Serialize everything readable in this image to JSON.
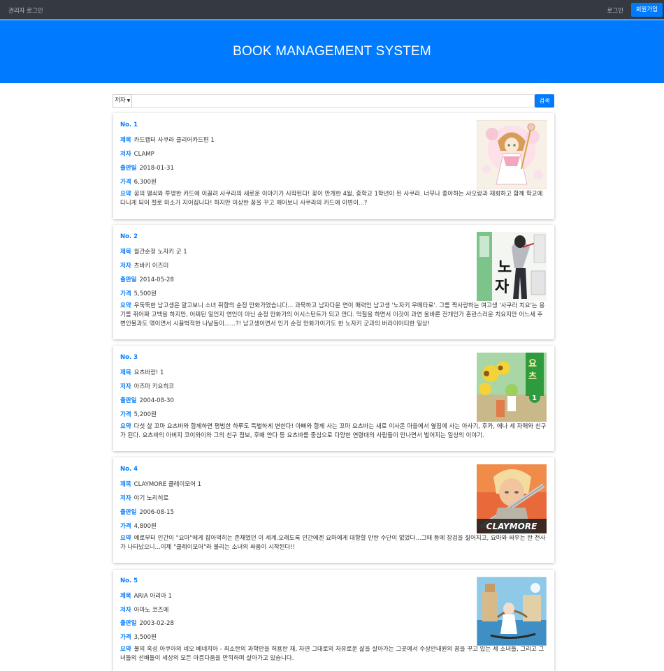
{
  "nav": {
    "admin_login": "관리자 로그인",
    "login": "로그인",
    "signup": "회원가입"
  },
  "hero": {
    "title": "BOOK MANAGEMENT SYSTEM"
  },
  "search": {
    "selected_option": "저자",
    "value": "",
    "button_label": "검색"
  },
  "labels": {
    "title": "제목",
    "author": "저자",
    "published": "출판일",
    "price": "가격",
    "summary": "요약"
  },
  "books": [
    {
      "no": "No. 1",
      "title": "카드캡터 사쿠라 클리어카드편 1",
      "author": "CLAMP",
      "published": "2018-01-31",
      "price": "6,300원",
      "summary": "꿈의 열쇠와 투명한 카드에 이끌려 사쿠라의 새로운 이야기가 시작된다! 꽃이 만개한 4월, 중학교 1학년이 된 사쿠라. 너무나 좋아하는 샤오랑과 재회하고 함께 학교에 다니게 되어 절로 미소가 지어집니다! 하지만 이상한 꿈을 꾸고 깨어보니 사쿠라의 카드에 이변이...?",
      "cover": "sakura-cover"
    },
    {
      "no": "No. 2",
      "title": "월간순정 노자키 군 1",
      "author": "츠바키 이즈미",
      "published": "2014-05-28",
      "price": "5,500원",
      "summary": "우둑뚝한 남고생은 알고보니 소녀 취향의 순정 만화가였습니다... 과묵하고 남자다운 면이 매력인 남고생 '노자키 우메타로'. 그를 짝사랑하는 여고생 '사쿠라 치요'는 용기를 쥐어짜 고백을 하지만, 어찌된 일인지 연인이 아닌 순정 만화가의 어시스턴트가 되고 만다. 먹칠을 하면서 이것이 과연 올바른 전개인가 혼란스러운 치요지만 어느새 주변인물과도 엮이면서 시끌벅적한 나날들이......?! 남고생이면서 인기 순정 만화가이기도 한 노자키 군과의 버라이어티한 일상!",
      "cover": "nozaki-cover"
    },
    {
      "no": "No. 3",
      "title": "요츠바랑! 1",
      "author": "아즈마 키요히코",
      "published": "2004-08-30",
      "price": "5,200원",
      "summary": "다섯 살 꼬마 요츠바와 함께하면 평범한 하루도 특별하게 변한다! 아빠와 함께 사는 꼬마 요츠바는 새로 이사온 마을에서 옆집에 사는 아사기, 후카, 에나 세 자매와 친구가 된다. 요츠바의 아버지 코이와이와 그의 친구 점보, 후배 얀다 등 요츠바를 중심으로 다양한 연령대의 사람들이 만나면서 벌어지는 일상의 이야기.",
      "cover": "yotsuba-cover"
    },
    {
      "no": "No. 4",
      "title": "CLAYMORE 클레이모어 1",
      "author": "야기 노리히로",
      "published": "2006-08-15",
      "price": "4,800원",
      "summary": "예로부터 인간이 \"요마\"에게 잡아먹히는 존재였던 이 세계.오래도록 인간에겐 요마에게 대항할 만한 수단이 없었다...그때 등에 장검을 짊어지고, 요마와 싸우는 한 전사가 나타났으니...이제 \"클레이모어\"라 불리는 소녀의 싸움이 시작된다!!",
      "cover": "claymore-cover",
      "cover_text": "CLAYMORE"
    },
    {
      "no": "No. 5",
      "title": "ARIA 아리아 1",
      "author": "아마노 코즈에",
      "published": "2003-02-28",
      "price": "3,500원",
      "summary": "물의 혹성 아쿠아의 네오 베네치아 - 최소한의 과학만을 허용한 채, 자연 그대로의 자유로운 삶을 살아가는 그곳에서 수상안내원의 꿈을 꾸고 있는 세 소녀들, 그리고 그녀들의 선배들이 세상의 모든 아름다움을 만끽하며 살아가고 있습니다.",
      "cover": "aria-cover"
    }
  ]
}
